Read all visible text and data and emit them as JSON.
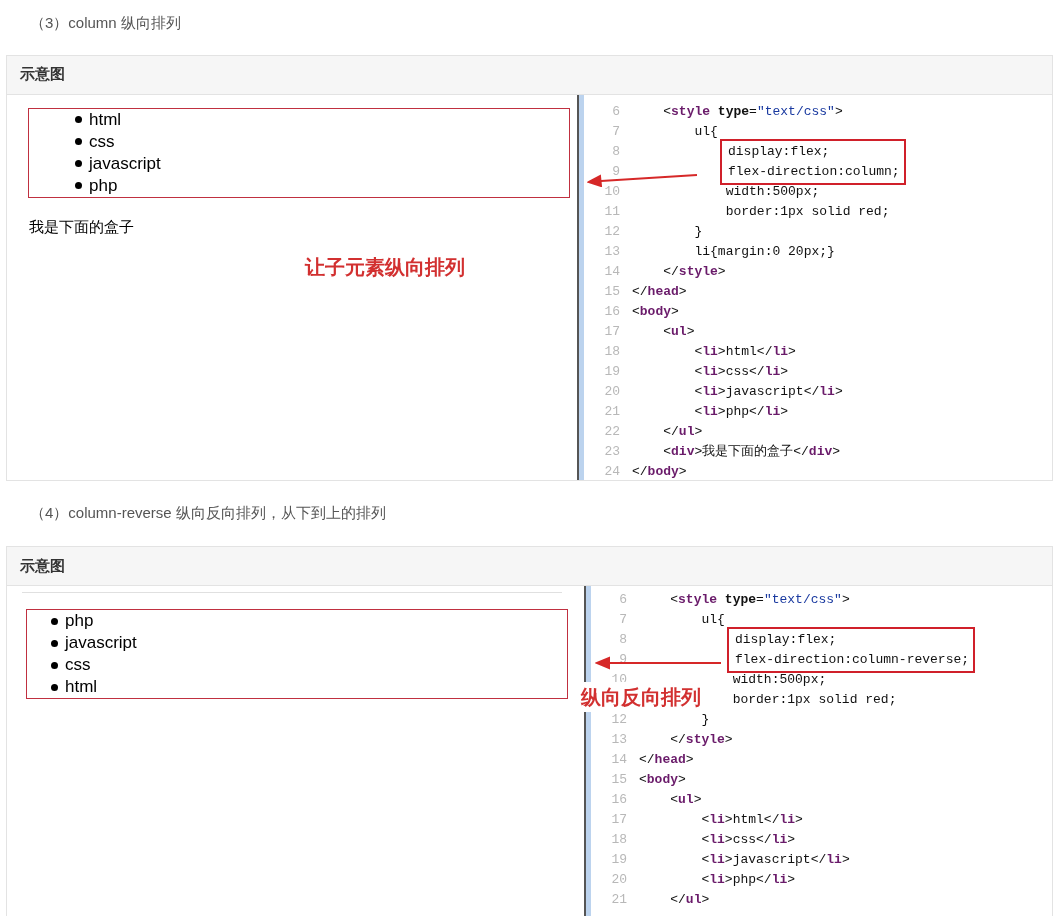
{
  "sections": [
    {
      "heading": "（3）column 纵向排列",
      "card": {
        "title": "示意图",
        "preview": {
          "items": [
            "html",
            "css",
            "javascript",
            "php"
          ],
          "below_text": "我是下面的盒子"
        },
        "callout": {
          "kind": "preview",
          "text": "让子元素纵向排列"
        },
        "code": {
          "lines": [
            {
              "number": "6",
              "boxed": false,
              "tokens": [
                {
                  "kind": "plain",
                  "text": "    <"
                },
                {
                  "kind": "tag",
                  "text": "style"
                },
                {
                  "kind": "attr",
                  "text": " type"
                },
                {
                  "kind": "plain",
                  "text": "="
                },
                {
                  "kind": "string",
                  "text": "\"text/css\""
                },
                {
                  "kind": "plain",
                  "text": ">"
                }
              ]
            },
            {
              "number": "7",
              "boxed": false,
              "tokens": [
                {
                  "kind": "plain",
                  "text": "        ul{"
                }
              ]
            },
            {
              "number": "8",
              "boxed": true,
              "tokens": [
                {
                  "kind": "plain",
                  "text": "display:flex;"
                }
              ]
            },
            {
              "number": "9",
              "boxed": true,
              "tokens": [
                {
                  "kind": "plain",
                  "text": "flex-direction:column;"
                }
              ]
            },
            {
              "number": "10",
              "boxed": false,
              "tokens": [
                {
                  "kind": "plain",
                  "text": "            width:500px;"
                }
              ]
            },
            {
              "number": "11",
              "boxed": false,
              "tokens": [
                {
                  "kind": "plain",
                  "text": "            border:1px solid red;"
                }
              ]
            },
            {
              "number": "12",
              "boxed": false,
              "tokens": [
                {
                  "kind": "plain",
                  "text": "        }"
                }
              ]
            },
            {
              "number": "13",
              "boxed": false,
              "tokens": [
                {
                  "kind": "plain",
                  "text": "        li{margin:0 20px;}"
                }
              ]
            },
            {
              "number": "14",
              "boxed": false,
              "tokens": [
                {
                  "kind": "plain",
                  "text": "    </"
                },
                {
                  "kind": "tag",
                  "text": "style"
                },
                {
                  "kind": "plain",
                  "text": ">"
                }
              ]
            },
            {
              "number": "15",
              "boxed": false,
              "tokens": [
                {
                  "kind": "plain",
                  "text": "</"
                },
                {
                  "kind": "tag",
                  "text": "head"
                },
                {
                  "kind": "plain",
                  "text": ">"
                }
              ]
            },
            {
              "number": "16",
              "boxed": false,
              "tokens": [
                {
                  "kind": "plain",
                  "text": "<"
                },
                {
                  "kind": "tag",
                  "text": "body"
                },
                {
                  "kind": "plain",
                  "text": ">"
                }
              ]
            },
            {
              "number": "17",
              "boxed": false,
              "tokens": [
                {
                  "kind": "plain",
                  "text": "    <"
                },
                {
                  "kind": "tag",
                  "text": "ul"
                },
                {
                  "kind": "plain",
                  "text": ">"
                }
              ]
            },
            {
              "number": "18",
              "boxed": false,
              "tokens": [
                {
                  "kind": "plain",
                  "text": "        <"
                },
                {
                  "kind": "tag",
                  "text": "li"
                },
                {
                  "kind": "plain",
                  "text": ">html</"
                },
                {
                  "kind": "tag",
                  "text": "li"
                },
                {
                  "kind": "plain",
                  "text": ">"
                }
              ]
            },
            {
              "number": "19",
              "boxed": false,
              "tokens": [
                {
                  "kind": "plain",
                  "text": "        <"
                },
                {
                  "kind": "tag",
                  "text": "li"
                },
                {
                  "kind": "plain",
                  "text": ">css</"
                },
                {
                  "kind": "tag",
                  "text": "li"
                },
                {
                  "kind": "plain",
                  "text": ">"
                }
              ]
            },
            {
              "number": "20",
              "boxed": false,
              "tokens": [
                {
                  "kind": "plain",
                  "text": "        <"
                },
                {
                  "kind": "tag",
                  "text": "li"
                },
                {
                  "kind": "plain",
                  "text": ">javascript</"
                },
                {
                  "kind": "tag",
                  "text": "li"
                },
                {
                  "kind": "plain",
                  "text": ">"
                }
              ]
            },
            {
              "number": "21",
              "boxed": false,
              "tokens": [
                {
                  "kind": "plain",
                  "text": "        <"
                },
                {
                  "kind": "tag",
                  "text": "li"
                },
                {
                  "kind": "plain",
                  "text": ">php</"
                },
                {
                  "kind": "tag",
                  "text": "li"
                },
                {
                  "kind": "plain",
                  "text": ">"
                }
              ]
            },
            {
              "number": "22",
              "boxed": false,
              "tokens": [
                {
                  "kind": "plain",
                  "text": "    </"
                },
                {
                  "kind": "tag",
                  "text": "ul"
                },
                {
                  "kind": "plain",
                  "text": ">"
                }
              ]
            },
            {
              "number": "23",
              "boxed": false,
              "tokens": [
                {
                  "kind": "plain",
                  "text": "    <"
                },
                {
                  "kind": "tag",
                  "text": "div"
                },
                {
                  "kind": "plain",
                  "text": ">我是下面的盒子</"
                },
                {
                  "kind": "tag",
                  "text": "div"
                },
                {
                  "kind": "plain",
                  "text": ">"
                }
              ]
            },
            {
              "number": "24",
              "boxed": false,
              "tokens": [
                {
                  "kind": "plain",
                  "text": "</"
                },
                {
                  "kind": "tag",
                  "text": "body"
                },
                {
                  "kind": "plain",
                  "text": ">"
                }
              ]
            }
          ]
        }
      }
    },
    {
      "heading": "（4）column-reverse 纵向反向排列，从下到上的排列",
      "card": {
        "title": "示意图",
        "preview": {
          "items": [
            "php",
            "javascript",
            "css",
            "html"
          ]
        },
        "callout": {
          "kind": "code",
          "text": "纵向反向排列"
        },
        "code": {
          "lines": [
            {
              "number": "6",
              "boxed": false,
              "tokens": [
                {
                  "kind": "plain",
                  "text": "    <"
                },
                {
                  "kind": "tag",
                  "text": "style"
                },
                {
                  "kind": "attr",
                  "text": " type"
                },
                {
                  "kind": "plain",
                  "text": "="
                },
                {
                  "kind": "string",
                  "text": "\"text/css\""
                },
                {
                  "kind": "plain",
                  "text": ">"
                }
              ]
            },
            {
              "number": "7",
              "boxed": false,
              "tokens": [
                {
                  "kind": "plain",
                  "text": "        ul{"
                }
              ]
            },
            {
              "number": "8",
              "boxed": true,
              "tokens": [
                {
                  "kind": "plain",
                  "text": "display:flex;"
                }
              ]
            },
            {
              "number": "9",
              "boxed": true,
              "tokens": [
                {
                  "kind": "plain",
                  "text": "flex-direction:column-reverse;"
                }
              ]
            },
            {
              "number": "10",
              "boxed": false,
              "tokens": [
                {
                  "kind": "plain",
                  "text": "            width:500px;"
                }
              ]
            },
            {
              "boxed": false,
              "tokens": [
                {
                  "kind": "plain",
                  "text": "            border:1px solid red;"
                }
              ]
            },
            {
              "number": "12",
              "boxed": false,
              "tokens": [
                {
                  "kind": "plain",
                  "text": "        }"
                }
              ]
            },
            {
              "number": "13",
              "boxed": false,
              "tokens": [
                {
                  "kind": "plain",
                  "text": "    </"
                },
                {
                  "kind": "tag",
                  "text": "style"
                },
                {
                  "kind": "plain",
                  "text": ">"
                }
              ]
            },
            {
              "number": "14",
              "boxed": false,
              "tokens": [
                {
                  "kind": "plain",
                  "text": "</"
                },
                {
                  "kind": "tag",
                  "text": "head"
                },
                {
                  "kind": "plain",
                  "text": ">"
                }
              ]
            },
            {
              "number": "15",
              "boxed": false,
              "tokens": [
                {
                  "kind": "plain",
                  "text": "<"
                },
                {
                  "kind": "tag",
                  "text": "body"
                },
                {
                  "kind": "plain",
                  "text": ">"
                }
              ]
            },
            {
              "number": "16",
              "boxed": false,
              "tokens": [
                {
                  "kind": "plain",
                  "text": "    <"
                },
                {
                  "kind": "tag",
                  "text": "ul"
                },
                {
                  "kind": "plain",
                  "text": ">"
                }
              ]
            },
            {
              "number": "17",
              "boxed": false,
              "tokens": [
                {
                  "kind": "plain",
                  "text": "        <"
                },
                {
                  "kind": "tag",
                  "text": "li"
                },
                {
                  "kind": "plain",
                  "text": ">html</"
                },
                {
                  "kind": "tag",
                  "text": "li"
                },
                {
                  "kind": "plain",
                  "text": ">"
                }
              ]
            },
            {
              "number": "18",
              "boxed": false,
              "tokens": [
                {
                  "kind": "plain",
                  "text": "        <"
                },
                {
                  "kind": "tag",
                  "text": "li"
                },
                {
                  "kind": "plain",
                  "text": ">css</"
                },
                {
                  "kind": "tag",
                  "text": "li"
                },
                {
                  "kind": "plain",
                  "text": ">"
                }
              ]
            },
            {
              "number": "19",
              "boxed": false,
              "tokens": [
                {
                  "kind": "plain",
                  "text": "        <"
                },
                {
                  "kind": "tag",
                  "text": "li"
                },
                {
                  "kind": "plain",
                  "text": ">javascript</"
                },
                {
                  "kind": "tag",
                  "text": "li"
                },
                {
                  "kind": "plain",
                  "text": ">"
                }
              ]
            },
            {
              "number": "20",
              "boxed": false,
              "tokens": [
                {
                  "kind": "plain",
                  "text": "        <"
                },
                {
                  "kind": "tag",
                  "text": "li"
                },
                {
                  "kind": "plain",
                  "text": ">php</"
                },
                {
                  "kind": "tag",
                  "text": "li"
                },
                {
                  "kind": "plain",
                  "text": ">"
                }
              ]
            },
            {
              "number": "21",
              "boxed": false,
              "tokens": [
                {
                  "kind": "plain",
                  "text": "    </"
                },
                {
                  "kind": "tag",
                  "text": "ul"
                },
                {
                  "kind": "plain",
                  "text": ">"
                }
              ]
            }
          ]
        }
      }
    }
  ]
}
